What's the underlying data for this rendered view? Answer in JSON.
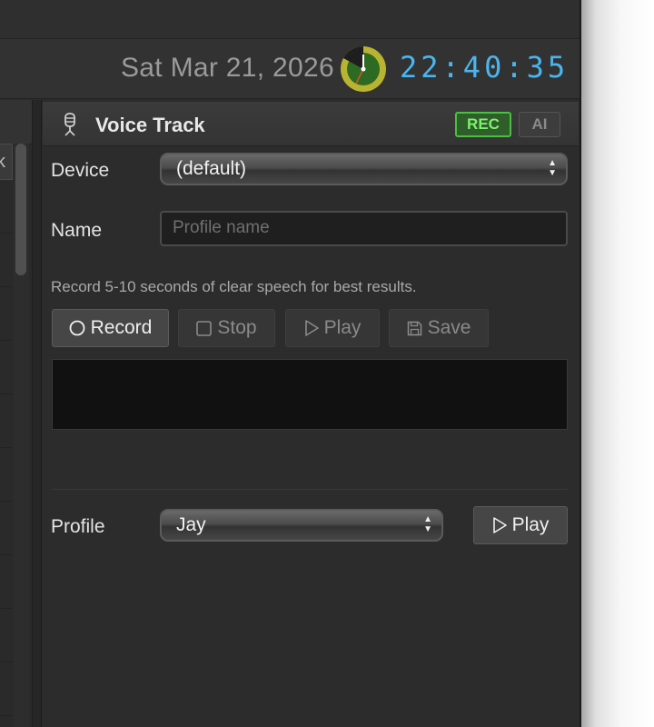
{
  "header": {
    "date": "Sat Mar 21, 2026",
    "time": "22:40:35"
  },
  "left_panel": {
    "column_header_fragment": "k"
  },
  "voice_track": {
    "title": "Voice Track",
    "badges": {
      "rec": "REC",
      "ai": "AI"
    },
    "device": {
      "label": "Device",
      "selected": "(default)"
    },
    "name": {
      "label": "Name",
      "value": "",
      "placeholder": "Profile name"
    },
    "hint": "Record 5-10 seconds of clear speech for best results.",
    "buttons": {
      "record": "Record",
      "stop": "Stop",
      "play": "Play",
      "save": "Save"
    },
    "profile": {
      "label": "Profile",
      "selected": "Jay",
      "play_label": "Play"
    }
  },
  "colors": {
    "clock_digits": "#49b6f0",
    "rec_badge": "#4bbf43",
    "panel_bg": "#2c2c2c"
  }
}
